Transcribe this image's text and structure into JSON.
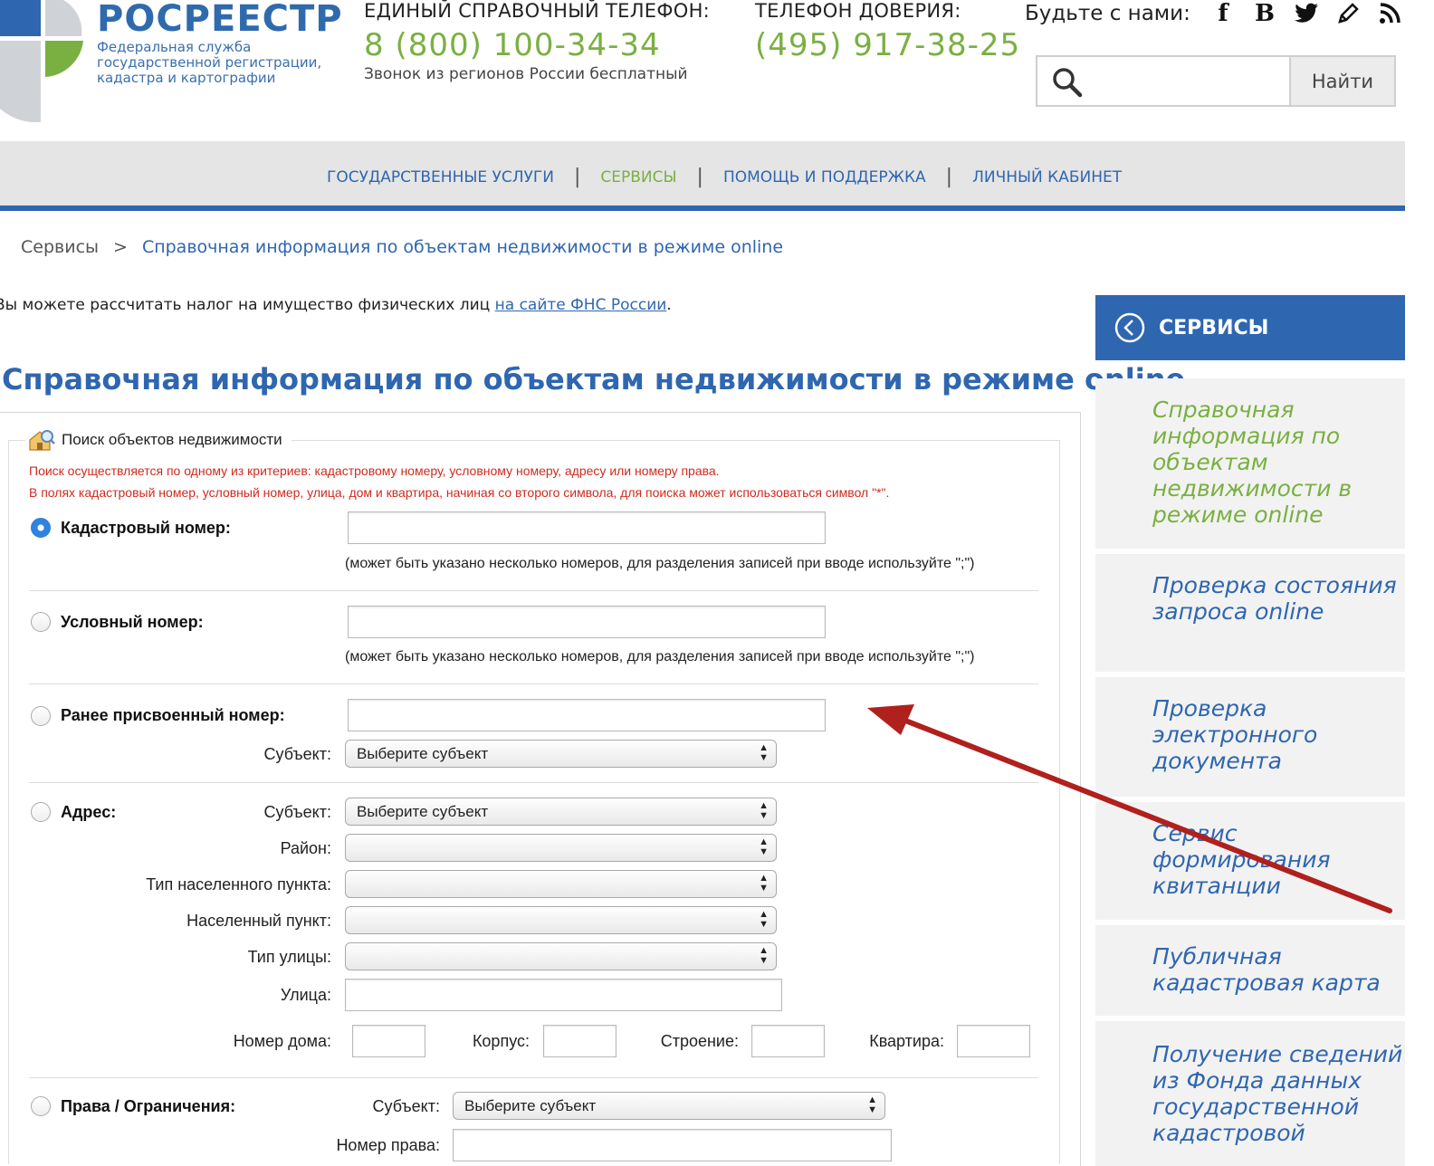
{
  "header": {
    "logo_title": "РОСРЕЕСТР",
    "logo_subtitle_lines": [
      "Федеральная служба",
      "государственной регистрации,",
      "кадастра и картографии"
    ],
    "help_label": "ЕДИНЫЙ СПРАВОЧНЫЙ ТЕЛЕФОН:",
    "help_phone": "8 (800) 100-34-34",
    "help_note": "Звонок из регионов России бесплатный",
    "trust_label": "ТЕЛЕФОН ДОВЕРИЯ:",
    "trust_phone": "(495) 917-38-25",
    "social_label": "Будьте с нами:",
    "social_icons": [
      "facebook-icon",
      "vkontakte-icon",
      "twitter-icon",
      "blog-icon",
      "rss-icon"
    ],
    "search_placeholder": "",
    "search_button": "Найти",
    "brand_blue": "#2f66b0",
    "brand_green": "#7ab042"
  },
  "nav": {
    "items": [
      {
        "label": "ГОСУДАРСТВЕННЫЕ УСЛУГИ",
        "active": false
      },
      {
        "label": "СЕРВИСЫ",
        "active": true
      },
      {
        "label": "ПОМОЩЬ И ПОДДЕРЖКА",
        "active": false
      },
      {
        "label": "ЛИЧНЫЙ КАБИНЕТ",
        "active": false
      }
    ],
    "separator": "|"
  },
  "breadcrumb": {
    "root": "Сервисы",
    "separator": ">",
    "current": "Справочная информация по объектам недвижимости в режиме online"
  },
  "tax_note": {
    "text": "Вы можете рассчитать налог на имущество физических лиц ",
    "link": "на сайте ФНС России",
    "end": "."
  },
  "page_title": "Справочная информация по объектам недвижимости в режиме online",
  "form": {
    "legend": "Поиск объектов недвижимости",
    "notes": [
      "Поиск осуществляется по одному из критериев: кадастровому номеру, условному номеру, адресу или номеру права.",
      "В полях кадастровый номер, условный номер, улица, дом и квартира, начиная со второго символа, для поиска может использоваться символ \"*\"."
    ],
    "cadastral": {
      "label": "Кадастровый номер:",
      "value": "",
      "hint": "(может быть указано несколько номеров, для разделения записей при вводе используйте \";\")",
      "checked": true
    },
    "conditional": {
      "label": "Условный номер:",
      "value": "",
      "hint": "(может быть указано несколько номеров, для разделения записей при вводе используйте \";\")",
      "checked": false
    },
    "previous": {
      "label": "Ранее присвоенный номер:",
      "value": "",
      "subject_label": "Субъект:",
      "subject_value": "Выберите субъект",
      "checked": false
    },
    "address": {
      "label": "Адрес:",
      "subject_label": "Субъект:",
      "subject_value": "Выберите субъект",
      "district_label": "Район:",
      "district_value": "",
      "settlement_type_label": "Тип населенного пункта:",
      "settlement_type_value": "",
      "settlement_label": "Населенный пункт:",
      "settlement_value": "",
      "street_type_label": "Тип улицы:",
      "street_type_value": "",
      "street_label": "Улица:",
      "street_value": "",
      "house_label": "Номер дома:",
      "house_value": "",
      "building_label": "Корпус:",
      "building_value": "",
      "structure_label": "Строение:",
      "structure_value": "",
      "apartment_label": "Квартира:",
      "apartment_value": "",
      "checked": false
    },
    "rights": {
      "label": "Права / Ограничения:",
      "subject_label": "Субъект:",
      "subject_value": "Выберите субъект",
      "number_label": "Номер права:",
      "number_value": "",
      "checked": false
    },
    "note_color": "#d02a1e"
  },
  "sidebar": {
    "title": "СЕРВИСЫ",
    "items": [
      {
        "label": "Справочная информация по объектам недвижимости в режиме online",
        "active": true
      },
      {
        "label": "Проверка состояния запроса online",
        "active": false
      },
      {
        "label": "Проверка электронного документа",
        "active": false
      },
      {
        "label": "Сервис формирования квитанции",
        "active": false
      },
      {
        "label": "Публичная кадастровая карта",
        "active": false
      },
      {
        "label": "Получение сведений из Фонда данных государственной кадастровой",
        "active": false
      }
    ]
  },
  "annotation": {
    "arrow_color": "#b0201c"
  }
}
